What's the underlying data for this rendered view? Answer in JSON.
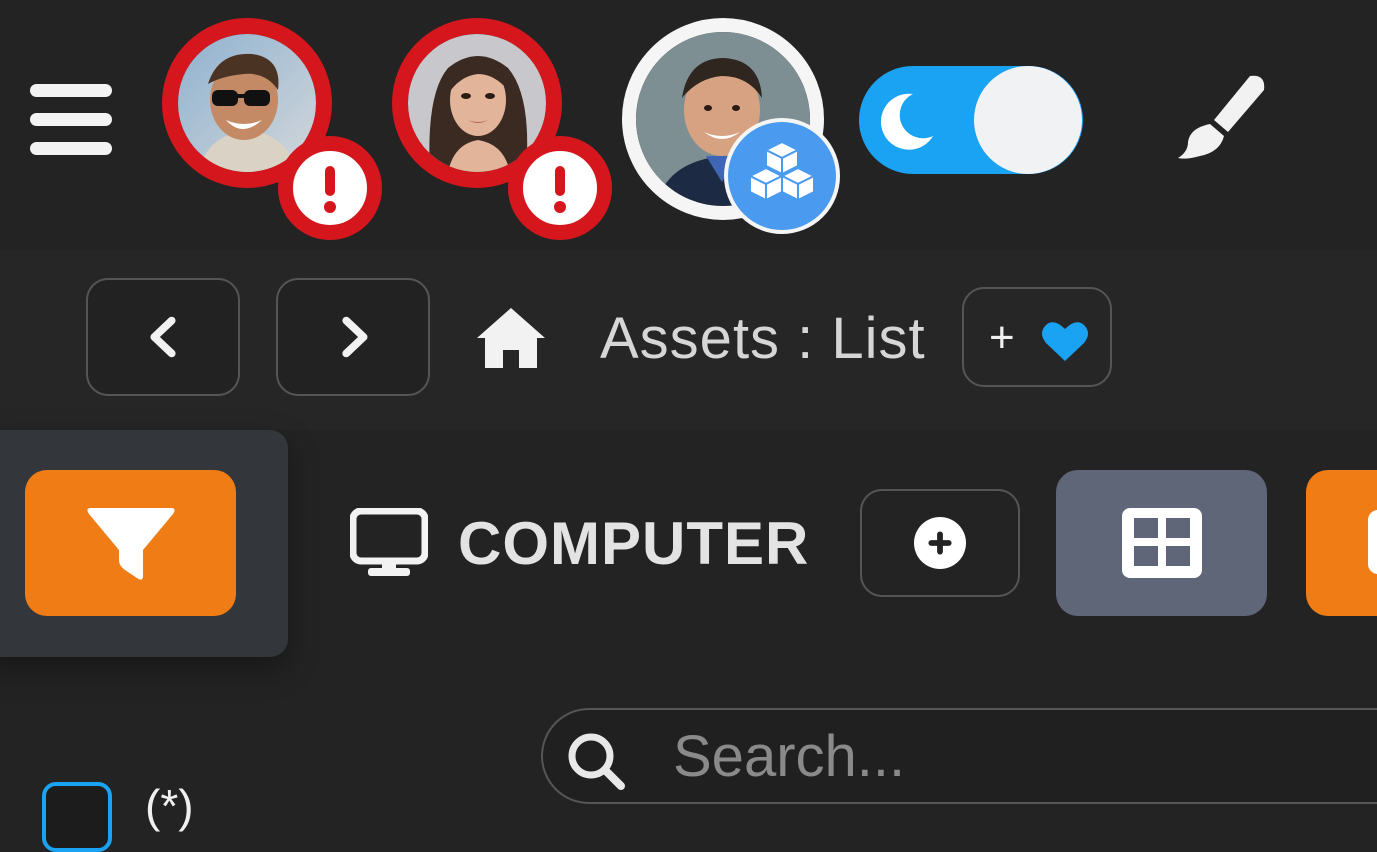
{
  "header": {
    "menu_icon": "hamburger-menu-icon",
    "users": [
      {
        "name_icon": "user-avatar-man-sunglasses",
        "status": "alert",
        "badge_icon": "exclamation-icon",
        "badge_text": "!"
      },
      {
        "name_icon": "user-avatar-woman",
        "status": "alert",
        "badge_icon": "exclamation-icon",
        "badge_text": "!"
      },
      {
        "name_icon": "user-avatar-man-suit",
        "status": "normal",
        "badge_icon": "cubes-icon"
      }
    ],
    "theme_toggle": {
      "icon": "moon-icon",
      "state": "dark"
    },
    "customize_icon": "paintbrush-icon"
  },
  "breadcrumb": {
    "back_icon": "chevron-left-icon",
    "forward_icon": "chevron-right-icon",
    "home_icon": "home-icon",
    "title": "Assets : List",
    "favorite": {
      "plus": "+",
      "icon": "heart-icon"
    }
  },
  "toolbar": {
    "filter_icon": "filter-icon",
    "section_icon": "desktop-monitor-icon",
    "section_title": "COMPUTER",
    "add_icon": "plus-circle-icon",
    "view_icon": "grid-view-icon"
  },
  "search": {
    "icon": "search-icon",
    "placeholder": "Search...",
    "value": ""
  },
  "list": {
    "select_all_label": "(*)"
  },
  "colors": {
    "background": "#232323",
    "alert_red": "#d5171d",
    "accent_blue": "#1aa3f2",
    "orange": "#f07c16",
    "grid_button": "#5e6678"
  }
}
